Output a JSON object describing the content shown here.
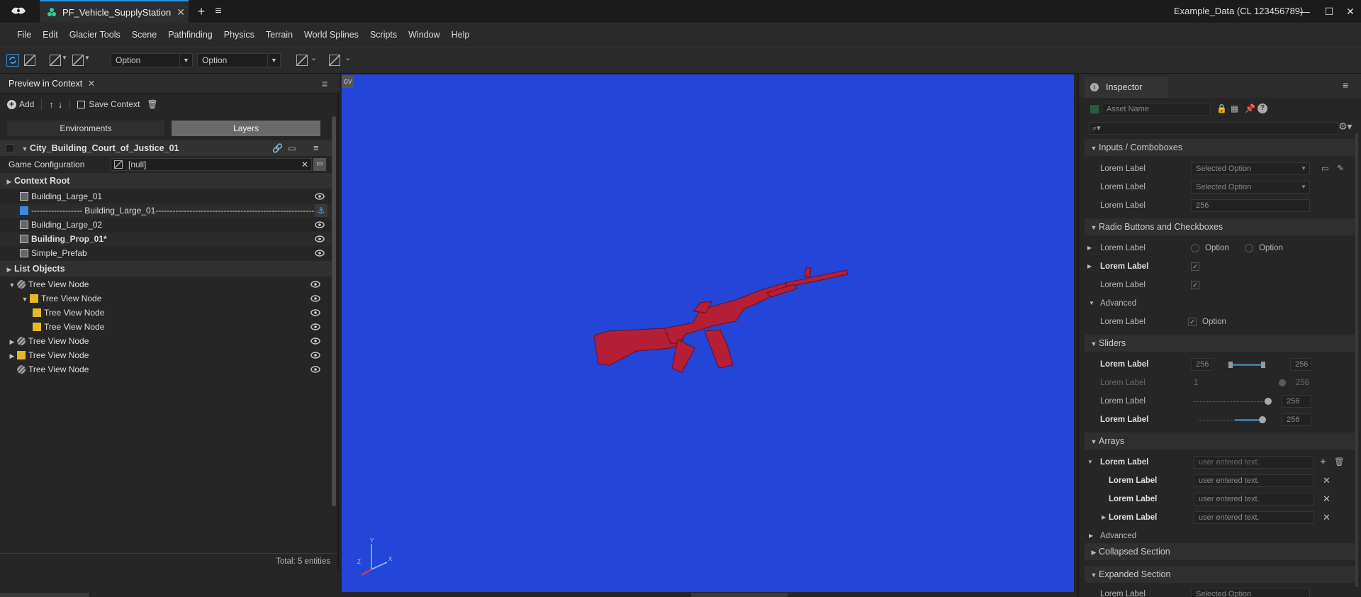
{
  "window": {
    "tab_title": "PF_Vehicle_SupplyStation",
    "project": "Example_Data (CL 123456789)"
  },
  "menu": [
    "File",
    "Edit",
    "Glacier Tools",
    "Scene",
    "Pathfinding",
    "Physics",
    "Terrain",
    "World Splines",
    "Scripts",
    "Window",
    "Help"
  ],
  "toolbar": {
    "combo1": "Option",
    "combo2": "Option"
  },
  "left": {
    "panel_title": "Preview in Context",
    "add_label": "Add",
    "save_label": "Save Context",
    "seg_environments": "Environments",
    "seg_layers": "Layers",
    "context_name": "City_Building_Court_of_Justice_01",
    "game_config_label": "Game Configuration",
    "game_config_value": "[null]",
    "context_root": "Context Root",
    "items": [
      {
        "label": "Building_Large_01",
        "bold": false
      },
      {
        "label": "------------------ Building_Large_01---------------------------------------------------------",
        "bold": false
      },
      {
        "label": "Building_Large_02",
        "bold": false
      },
      {
        "label": "Building_Prop_01*",
        "bold": true
      },
      {
        "label": "Simple_Prefab",
        "bold": false
      }
    ],
    "list_objects": "List Objects",
    "tree": [
      "Tree View Node",
      "Tree View Node",
      "Tree View Node",
      "Tree View Node",
      "Tree View Node",
      "Tree View Node",
      "Tree View Node"
    ],
    "footer": "Total: 5  entities"
  },
  "viewport": {
    "badge": "GV",
    "axis_y": "Y",
    "axis_x": "X",
    "axis_z": "Z"
  },
  "inspector": {
    "tab": "Inspector",
    "asset_placeholder": "Asset Name",
    "sections": {
      "inputs": "Inputs / Comboboxes",
      "radio": "Radio Buttons and Checkboxes",
      "advanced": "Advanced",
      "sliders": "Sliders",
      "arrays": "Arrays",
      "advanced2": "Advanced",
      "collapsed": "Collapsed Section",
      "expanded": "Expanded Section"
    },
    "label": "Lorem Label",
    "selected_option": "Selected Option",
    "value_256": "256",
    "value_1": "1",
    "option": "Option",
    "user_text": "user entered text."
  },
  "colors": {
    "viewport": "#2345d8",
    "accent": "#2f8fd8",
    "model": "#b51f35"
  }
}
